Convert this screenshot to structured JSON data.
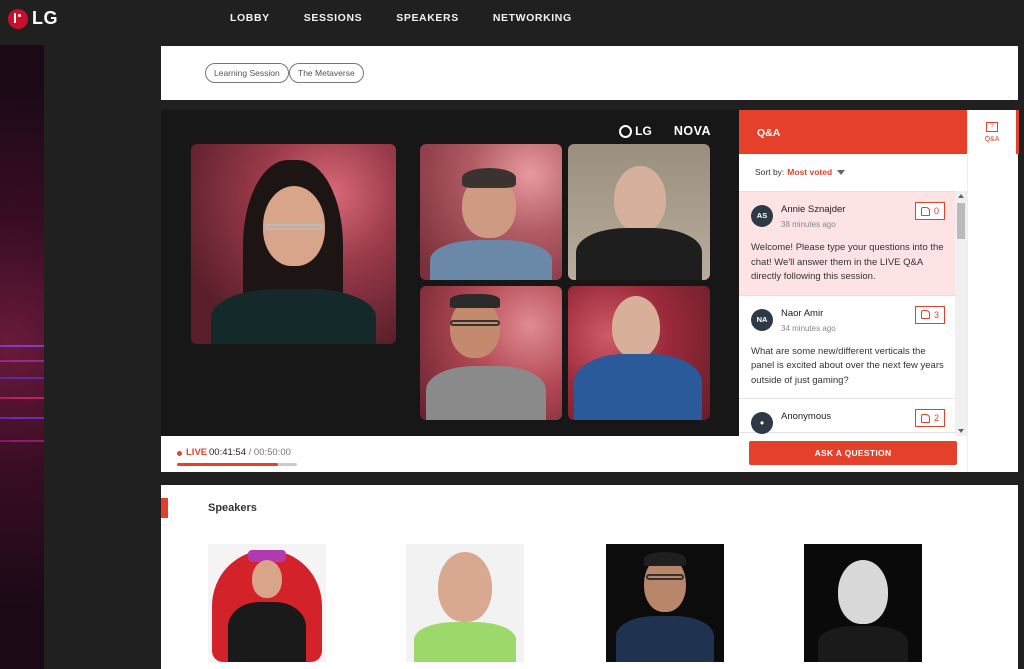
{
  "brand": {
    "logo_text": "LG"
  },
  "nav": {
    "items": [
      "LOBBY",
      "SESSIONS",
      "SPEAKERS",
      "NETWORKING"
    ]
  },
  "tags": [
    "Learning Session",
    "The Metaverse"
  ],
  "player": {
    "brand_logo": "LG",
    "brand_product": "NOVA",
    "live_label": "LIVE",
    "elapsed": "00:41:54",
    "separator": " / ",
    "total": "00:50:00",
    "progress_fraction": 0.838
  },
  "qa": {
    "title": "Q&A",
    "sort_label": "Sort by:",
    "sort_value": "Most voted",
    "items": [
      {
        "initials": "AS",
        "name": "Annie Sznajder",
        "time": "38 minutes ago",
        "votes": "0",
        "text": "Welcome! Please type your questions into the chat! We'll answer them in the LIVE Q&A directly following this session."
      },
      {
        "initials": "NA",
        "name": "Naor Amir",
        "time": "34 minutes ago",
        "votes": "3",
        "text": "What are some new/different verticals the panel is excited about over the next few years outside of just gaming?"
      },
      {
        "initials": "",
        "name": "Anonymous",
        "time": "",
        "votes": "2",
        "text": ""
      }
    ],
    "ask_button": "ASK A QUESTION"
  },
  "tabstrip": {
    "qa_icon_text": "?",
    "qa_label": "Q&A"
  },
  "speakers": {
    "title": "Speakers"
  },
  "colors": {
    "accent": "#e5402a",
    "nav_bg": "#202020",
    "highlight": "#fde3e3"
  }
}
